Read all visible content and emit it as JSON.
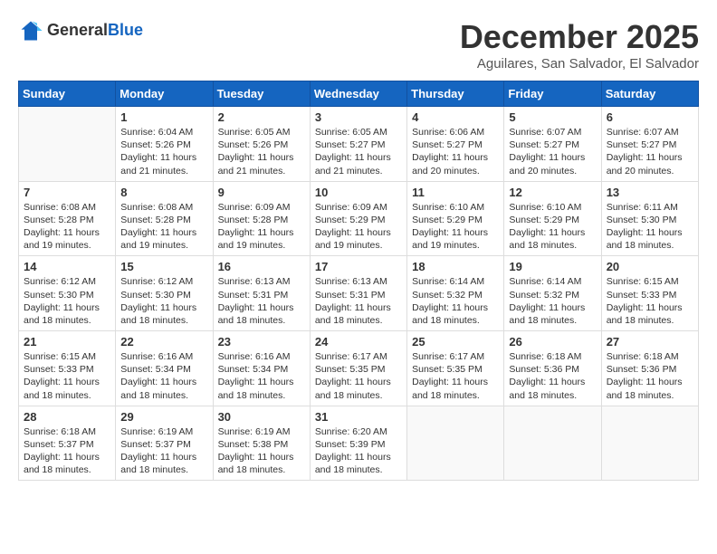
{
  "header": {
    "logo": {
      "general": "General",
      "blue": "Blue",
      "tagline": "General Blue"
    },
    "title": "December 2025",
    "location": "Aguilares, San Salvador, El Salvador"
  },
  "weekdays": [
    "Sunday",
    "Monday",
    "Tuesday",
    "Wednesday",
    "Thursday",
    "Friday",
    "Saturday"
  ],
  "weeks": [
    [
      {
        "day": "",
        "sunrise": "",
        "sunset": "",
        "daylight": ""
      },
      {
        "day": "1",
        "sunrise": "Sunrise: 6:04 AM",
        "sunset": "Sunset: 5:26 PM",
        "daylight": "Daylight: 11 hours and 21 minutes."
      },
      {
        "day": "2",
        "sunrise": "Sunrise: 6:05 AM",
        "sunset": "Sunset: 5:26 PM",
        "daylight": "Daylight: 11 hours and 21 minutes."
      },
      {
        "day": "3",
        "sunrise": "Sunrise: 6:05 AM",
        "sunset": "Sunset: 5:27 PM",
        "daylight": "Daylight: 11 hours and 21 minutes."
      },
      {
        "day": "4",
        "sunrise": "Sunrise: 6:06 AM",
        "sunset": "Sunset: 5:27 PM",
        "daylight": "Daylight: 11 hours and 20 minutes."
      },
      {
        "day": "5",
        "sunrise": "Sunrise: 6:07 AM",
        "sunset": "Sunset: 5:27 PM",
        "daylight": "Daylight: 11 hours and 20 minutes."
      },
      {
        "day": "6",
        "sunrise": "Sunrise: 6:07 AM",
        "sunset": "Sunset: 5:27 PM",
        "daylight": "Daylight: 11 hours and 20 minutes."
      }
    ],
    [
      {
        "day": "7",
        "sunrise": "Sunrise: 6:08 AM",
        "sunset": "Sunset: 5:28 PM",
        "daylight": "Daylight: 11 hours and 19 minutes."
      },
      {
        "day": "8",
        "sunrise": "Sunrise: 6:08 AM",
        "sunset": "Sunset: 5:28 PM",
        "daylight": "Daylight: 11 hours and 19 minutes."
      },
      {
        "day": "9",
        "sunrise": "Sunrise: 6:09 AM",
        "sunset": "Sunset: 5:28 PM",
        "daylight": "Daylight: 11 hours and 19 minutes."
      },
      {
        "day": "10",
        "sunrise": "Sunrise: 6:09 AM",
        "sunset": "Sunset: 5:29 PM",
        "daylight": "Daylight: 11 hours and 19 minutes."
      },
      {
        "day": "11",
        "sunrise": "Sunrise: 6:10 AM",
        "sunset": "Sunset: 5:29 PM",
        "daylight": "Daylight: 11 hours and 19 minutes."
      },
      {
        "day": "12",
        "sunrise": "Sunrise: 6:10 AM",
        "sunset": "Sunset: 5:29 PM",
        "daylight": "Daylight: 11 hours and 18 minutes."
      },
      {
        "day": "13",
        "sunrise": "Sunrise: 6:11 AM",
        "sunset": "Sunset: 5:30 PM",
        "daylight": "Daylight: 11 hours and 18 minutes."
      }
    ],
    [
      {
        "day": "14",
        "sunrise": "Sunrise: 6:12 AM",
        "sunset": "Sunset: 5:30 PM",
        "daylight": "Daylight: 11 hours and 18 minutes."
      },
      {
        "day": "15",
        "sunrise": "Sunrise: 6:12 AM",
        "sunset": "Sunset: 5:30 PM",
        "daylight": "Daylight: 11 hours and 18 minutes."
      },
      {
        "day": "16",
        "sunrise": "Sunrise: 6:13 AM",
        "sunset": "Sunset: 5:31 PM",
        "daylight": "Daylight: 11 hours and 18 minutes."
      },
      {
        "day": "17",
        "sunrise": "Sunrise: 6:13 AM",
        "sunset": "Sunset: 5:31 PM",
        "daylight": "Daylight: 11 hours and 18 minutes."
      },
      {
        "day": "18",
        "sunrise": "Sunrise: 6:14 AM",
        "sunset": "Sunset: 5:32 PM",
        "daylight": "Daylight: 11 hours and 18 minutes."
      },
      {
        "day": "19",
        "sunrise": "Sunrise: 6:14 AM",
        "sunset": "Sunset: 5:32 PM",
        "daylight": "Daylight: 11 hours and 18 minutes."
      },
      {
        "day": "20",
        "sunrise": "Sunrise: 6:15 AM",
        "sunset": "Sunset: 5:33 PM",
        "daylight": "Daylight: 11 hours and 18 minutes."
      }
    ],
    [
      {
        "day": "21",
        "sunrise": "Sunrise: 6:15 AM",
        "sunset": "Sunset: 5:33 PM",
        "daylight": "Daylight: 11 hours and 18 minutes."
      },
      {
        "day": "22",
        "sunrise": "Sunrise: 6:16 AM",
        "sunset": "Sunset: 5:34 PM",
        "daylight": "Daylight: 11 hours and 18 minutes."
      },
      {
        "day": "23",
        "sunrise": "Sunrise: 6:16 AM",
        "sunset": "Sunset: 5:34 PM",
        "daylight": "Daylight: 11 hours and 18 minutes."
      },
      {
        "day": "24",
        "sunrise": "Sunrise: 6:17 AM",
        "sunset": "Sunset: 5:35 PM",
        "daylight": "Daylight: 11 hours and 18 minutes."
      },
      {
        "day": "25",
        "sunrise": "Sunrise: 6:17 AM",
        "sunset": "Sunset: 5:35 PM",
        "daylight": "Daylight: 11 hours and 18 minutes."
      },
      {
        "day": "26",
        "sunrise": "Sunrise: 6:18 AM",
        "sunset": "Sunset: 5:36 PM",
        "daylight": "Daylight: 11 hours and 18 minutes."
      },
      {
        "day": "27",
        "sunrise": "Sunrise: 6:18 AM",
        "sunset": "Sunset: 5:36 PM",
        "daylight": "Daylight: 11 hours and 18 minutes."
      }
    ],
    [
      {
        "day": "28",
        "sunrise": "Sunrise: 6:18 AM",
        "sunset": "Sunset: 5:37 PM",
        "daylight": "Daylight: 11 hours and 18 minutes."
      },
      {
        "day": "29",
        "sunrise": "Sunrise: 6:19 AM",
        "sunset": "Sunset: 5:37 PM",
        "daylight": "Daylight: 11 hours and 18 minutes."
      },
      {
        "day": "30",
        "sunrise": "Sunrise: 6:19 AM",
        "sunset": "Sunset: 5:38 PM",
        "daylight": "Daylight: 11 hours and 18 minutes."
      },
      {
        "day": "31",
        "sunrise": "Sunrise: 6:20 AM",
        "sunset": "Sunset: 5:39 PM",
        "daylight": "Daylight: 11 hours and 18 minutes."
      },
      {
        "day": "",
        "sunrise": "",
        "sunset": "",
        "daylight": ""
      },
      {
        "day": "",
        "sunrise": "",
        "sunset": "",
        "daylight": ""
      },
      {
        "day": "",
        "sunrise": "",
        "sunset": "",
        "daylight": ""
      }
    ]
  ]
}
